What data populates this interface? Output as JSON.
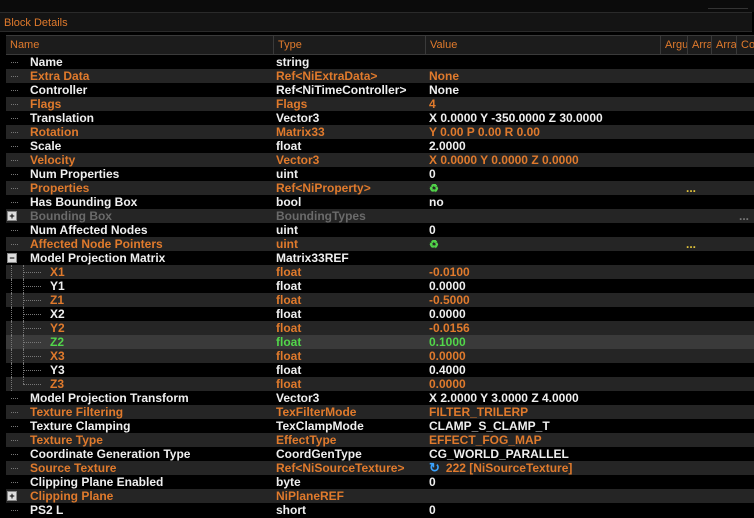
{
  "panel": {
    "title": "Block Details"
  },
  "columns": [
    "Name",
    "Type",
    "Value",
    "Argu",
    "Arra",
    "Arra",
    "Co"
  ],
  "rows": [
    {
      "name": "Name",
      "type": "string",
      "value": "",
      "c": "w",
      "lvl": 0
    },
    {
      "name": "Extra Data",
      "type": "Ref<NiExtraData>",
      "value": "None",
      "c": "o",
      "lvl": 0
    },
    {
      "name": "Controller",
      "type": "Ref<NiTimeController>",
      "value": "None",
      "c": "w",
      "lvl": 0
    },
    {
      "name": "Flags",
      "type": "Flags",
      "value": "4",
      "c": "o",
      "lvl": 0
    },
    {
      "name": "Translation",
      "type": "Vector3",
      "value": "X 0.0000 Y -350.0000 Z 30.0000",
      "c": "w",
      "lvl": 0
    },
    {
      "name": "Rotation",
      "type": "Matrix33",
      "value": "Y 0.00 P 0.00 R 0.00",
      "c": "o",
      "lvl": 0
    },
    {
      "name": "Scale",
      "type": "float",
      "value": "2.0000",
      "c": "w",
      "lvl": 0
    },
    {
      "name": "Velocity",
      "type": "Vector3",
      "value": "X 0.0000 Y 0.0000 Z 0.0000",
      "c": "o",
      "lvl": 0
    },
    {
      "name": "Num Properties",
      "type": "uint",
      "value": "0",
      "c": "w",
      "lvl": 0
    },
    {
      "name": "Properties",
      "type": "Ref<NiProperty>",
      "value": "",
      "icon": "refresh-icon",
      "dots": "...",
      "c": "o",
      "lvl": 0
    },
    {
      "name": "Has Bounding Box",
      "type": "bool",
      "value": "no",
      "c": "w",
      "lvl": 0
    },
    {
      "name": "Bounding Box",
      "type": "BoundingTypes",
      "value": "",
      "c": "g",
      "lvl": 0,
      "exp": "+",
      "dots2": "..."
    },
    {
      "name": "Num Affected Nodes",
      "type": "uint",
      "value": "0",
      "c": "w",
      "lvl": 0
    },
    {
      "name": "Affected Node Pointers",
      "type": "uint",
      "value": "",
      "icon": "refresh-icon",
      "dots": "...",
      "c": "o",
      "lvl": 0
    },
    {
      "name": "Model Projection Matrix",
      "type": "Matrix33REF",
      "value": "",
      "c": "w",
      "lvl": 0,
      "exp": "-"
    },
    {
      "name": "X1",
      "type": "float",
      "value": "-0.0100",
      "c": "o",
      "lvl": 1
    },
    {
      "name": "Y1",
      "type": "float",
      "value": "0.0000",
      "c": "w",
      "lvl": 1
    },
    {
      "name": "Z1",
      "type": "float",
      "value": "-0.5000",
      "c": "o",
      "lvl": 1
    },
    {
      "name": "X2",
      "type": "float",
      "value": "0.0000",
      "c": "w",
      "lvl": 1
    },
    {
      "name": "Y2",
      "type": "float",
      "value": "-0.0156",
      "c": "o",
      "lvl": 1
    },
    {
      "name": "Z2",
      "type": "float",
      "value": "0.1000",
      "c": "gr",
      "lvl": 1,
      "sel": true
    },
    {
      "name": "X3",
      "type": "float",
      "value": "0.0000",
      "c": "o",
      "lvl": 1
    },
    {
      "name": "Y3",
      "type": "float",
      "value": "0.4000",
      "c": "w",
      "lvl": 1
    },
    {
      "name": "Z3",
      "type": "float",
      "value": "0.0000",
      "c": "o",
      "lvl": 1,
      "last": true
    },
    {
      "name": "Model Projection Transform",
      "type": "Vector3",
      "value": "X 2.0000 Y 3.0000 Z 4.0000",
      "c": "w",
      "lvl": 0
    },
    {
      "name": "Texture Filtering",
      "type": "TexFilterMode",
      "value": "FILTER_TRILERP",
      "c": "o",
      "lvl": 0
    },
    {
      "name": "Texture Clamping",
      "type": "TexClampMode",
      "value": "CLAMP_S_CLAMP_T",
      "c": "w",
      "lvl": 0
    },
    {
      "name": "Texture Type",
      "type": "EffectType",
      "value": "EFFECT_FOG_MAP",
      "c": "o",
      "lvl": 0
    },
    {
      "name": "Coordinate Generation Type",
      "type": "CoordGenType",
      "value": "CG_WORLD_PARALLEL",
      "c": "w",
      "lvl": 0
    },
    {
      "name": "Source Texture",
      "type": "Ref<NiSourceTexture>",
      "value": "222 [NiSourceTexture]",
      "icon": "link-icon",
      "c": "o",
      "lvl": 0
    },
    {
      "name": "Clipping Plane Enabled",
      "type": "byte",
      "value": "0",
      "c": "w",
      "lvl": 0
    },
    {
      "name": "Clipping Plane",
      "type": "NiPlaneREF",
      "value": "",
      "c": "o",
      "lvl": 0,
      "exp": "+"
    },
    {
      "name": "PS2 L",
      "type": "short",
      "value": "0",
      "c": "w",
      "lvl": 0
    }
  ]
}
